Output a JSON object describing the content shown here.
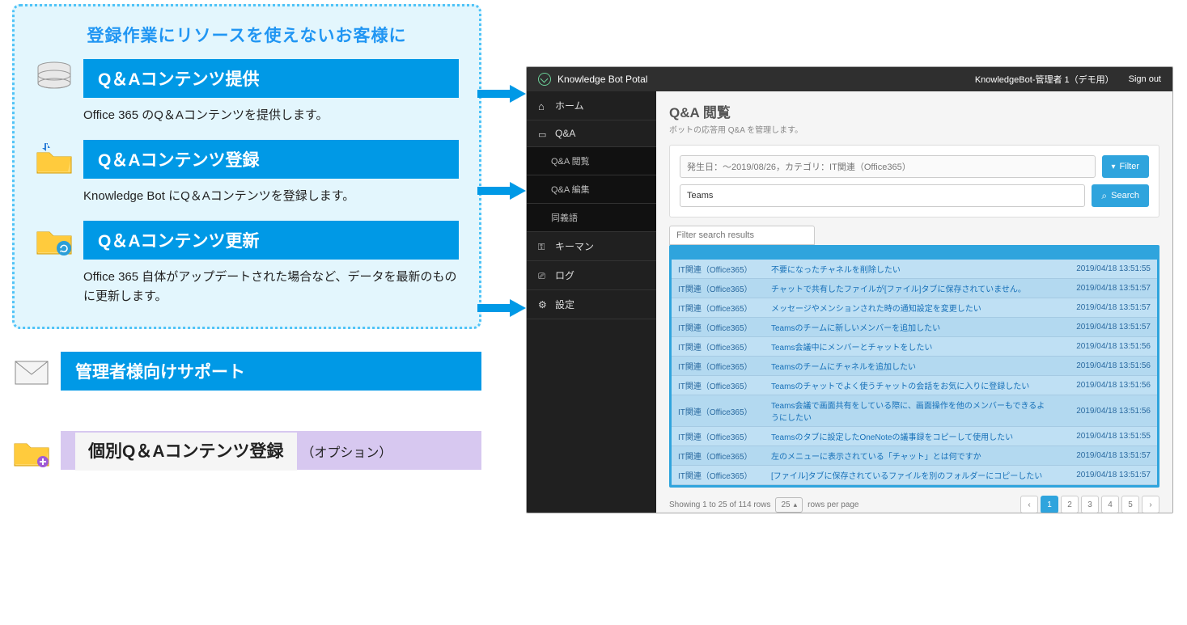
{
  "left": {
    "callout_title": "登録作業にリソースを使えないお客様に",
    "features": [
      {
        "title": "Q＆Aコンテンツ提供",
        "desc": "Office 365 のQ＆Aコンテンツを提供します。"
      },
      {
        "title": "Q＆Aコンテンツ登録",
        "desc": "Knowledge Bot にQ＆Aコンテンツを登録します。"
      },
      {
        "title": "Q＆Aコンテンツ更新",
        "desc": "Office 365 自体がアップデートされた場合など、データを最新のものに更新します。"
      }
    ],
    "support": "管理者様向けサポート",
    "option_main": "個別Q＆Aコンテンツ登録",
    "option_sub": "（オプション）"
  },
  "portal": {
    "brand": "Knowledge Bot Potal",
    "user": "KnowledgeBot-管理者 1（デモ用）",
    "signout": "Sign out",
    "sidebar": {
      "home": "ホーム",
      "qa": "Q&A",
      "qa_view": "Q&A 閲覧",
      "qa_edit": "Q&A 編集",
      "synonym": "同義語",
      "keyman": "キーマン",
      "log": "ログ",
      "settings": "設定"
    },
    "page_title": "Q&A 閲覧",
    "page_sub": "ボットの応答用 Q&A を管理します。",
    "filter_display": "発生日：〜2019/08/26，カテゴリ：IT関連（Office365）",
    "filter_btn": "Filter",
    "search_value": "Teams",
    "search_btn": "Search",
    "filter_results_ph": "Filter search results",
    "rows": [
      {
        "cat": "IT関連（Office365）",
        "title": "不要になったチャネルを削除したい",
        "dt": "2019/04/18 13:51:55"
      },
      {
        "cat": "IT関連（Office365）",
        "title": "チャットで共有したファイルが[ファイル]タブに保存されていません。",
        "dt": "2019/04/18 13:51:57"
      },
      {
        "cat": "IT関連（Office365）",
        "title": "メッセージやメンションされた時の通知設定を変更したい",
        "dt": "2019/04/18 13:51:57"
      },
      {
        "cat": "IT関連（Office365）",
        "title": "Teamsのチームに新しいメンバーを追加したい",
        "dt": "2019/04/18 13:51:57"
      },
      {
        "cat": "IT関連（Office365）",
        "title": "Teams会議中にメンバーとチャットをしたい",
        "dt": "2019/04/18 13:51:56"
      },
      {
        "cat": "IT関連（Office365）",
        "title": "Teamsのチームにチャネルを追加したい",
        "dt": "2019/04/18 13:51:56"
      },
      {
        "cat": "IT関連（Office365）",
        "title": "Teamsのチャットでよく使うチャットの会話をお気に入りに登録したい",
        "dt": "2019/04/18 13:51:56"
      },
      {
        "cat": "IT関連（Office365）",
        "title": "Teams会議で画面共有をしている際に、画面操作を他のメンバーもできるようにしたい",
        "dt": "2019/04/18 13:51:56"
      },
      {
        "cat": "IT関連（Office365）",
        "title": "Teamsのタブに設定したOneNoteの議事録をコピーして使用したい",
        "dt": "2019/04/18 13:51:55"
      },
      {
        "cat": "IT関連（Office365）",
        "title": "左のメニューに表示されている「チャット」とは何ですか",
        "dt": "2019/04/18 13:51:57"
      },
      {
        "cat": "IT関連（Office365）",
        "title": "[ファイル]タブに保存されているファイルを別のフォルダーにコピーしたい",
        "dt": "2019/04/18 13:51:57"
      }
    ],
    "pager_info": "Showing 1 to 25 of 114 rows",
    "page_size": "25",
    "pager_suffix": "rows per page",
    "pages": [
      "‹",
      "1",
      "2",
      "3",
      "4",
      "5",
      "›"
    ],
    "active_page": 1
  }
}
